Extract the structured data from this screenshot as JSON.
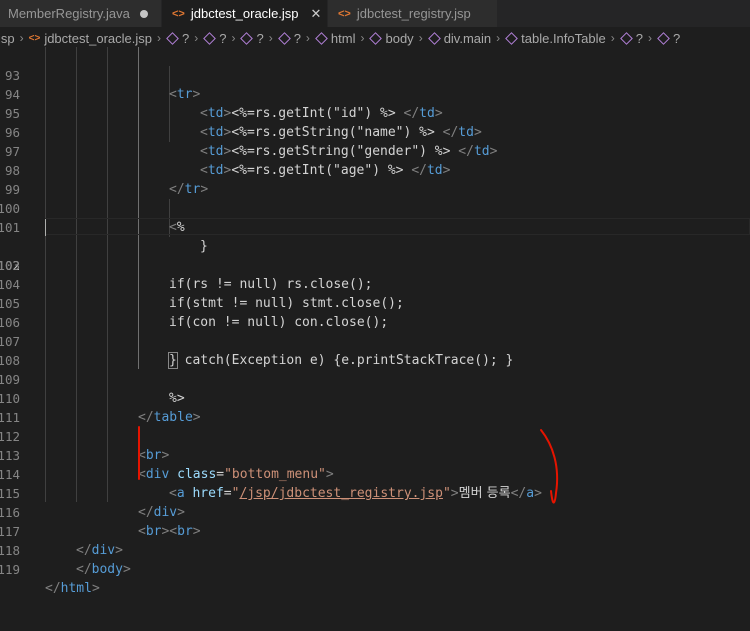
{
  "tabs": [
    {
      "label": "MemberRegistry.java",
      "active": false,
      "modified": true
    },
    {
      "label": "jdbctest_oracle.jsp",
      "active": true,
      "close": "✕"
    },
    {
      "label": "jdbctest_registry.jsp",
      "active": false
    }
  ],
  "breadcrumb": {
    "prefix": "jsp",
    "file": "jdbctest_oracle.jsp",
    "items": [
      "?",
      "?",
      "?",
      "?",
      "html",
      "body",
      "div.main",
      "table.InfoTable",
      "?",
      "?"
    ]
  },
  "editor": {
    "current_line": 102,
    "lines": [
      {
        "n": "93"
      },
      {
        "n": "94"
      },
      {
        "n": "95"
      },
      {
        "n": "96"
      },
      {
        "n": "97"
      },
      {
        "n": "98"
      },
      {
        "n": "99"
      },
      {
        "n": "100"
      },
      {
        "n": "101"
      },
      {
        "n": "102"
      },
      {
        "n": "103"
      },
      {
        "n": "104"
      },
      {
        "n": "105"
      },
      {
        "n": "106"
      },
      {
        "n": "107"
      },
      {
        "n": "108"
      },
      {
        "n": "109"
      },
      {
        "n": "110"
      },
      {
        "n": "111"
      },
      {
        "n": "112"
      },
      {
        "n": "113"
      },
      {
        "n": "114"
      },
      {
        "n": "115"
      },
      {
        "n": "116"
      },
      {
        "n": "117"
      },
      {
        "n": "118"
      },
      {
        "n": "119"
      }
    ],
    "code": {
      "l93_tr": "tr",
      "l94_td": "td",
      "l94_expr": "<%=rs.getInt(\"id\") %>",
      "l95_td": "td",
      "l95_expr": "<%=rs.getString(\"name\") %>",
      "l96_td": "td",
      "l96_expr": "<%=rs.getString(\"gender\") %>",
      "l97_td": "td",
      "l97_expr": "<%=rs.getInt(\"age\") %>",
      "l98_tr": "tr",
      "l100": "%",
      "l101": "}",
      "l103": "if(rs != null) rs.close();",
      "l104": "if(stmt != null) stmt.close();",
      "l105": "if(con != null) con.close();",
      "l107_brace": "}",
      "l107_rest": " catch(Exception e) {e.printStackTrace(); }",
      "l109": "%>",
      "l110_table": "table",
      "l112_br": "br",
      "l113_div": "div",
      "l113_attr": "class",
      "l113_val": "\"bottom_menu\"",
      "l114_a": "a",
      "l114_attr": "href",
      "l114_q1": "\"",
      "l114_val": "/jsp/jdbctest_registry.jsp",
      "l114_q2": "\"",
      "l114_text": "멤버 등록",
      "l115_div": "div",
      "l116_br1": "br",
      "l116_br2": "br",
      "l117_div": "div",
      "l118_body": "body",
      "l119_html": "html"
    }
  },
  "colors": {
    "tag": "#569cd6",
    "attr": "#9cdcfe",
    "string": "#ce9178",
    "text": "#d4d4d4",
    "annotation": "#e51400"
  }
}
